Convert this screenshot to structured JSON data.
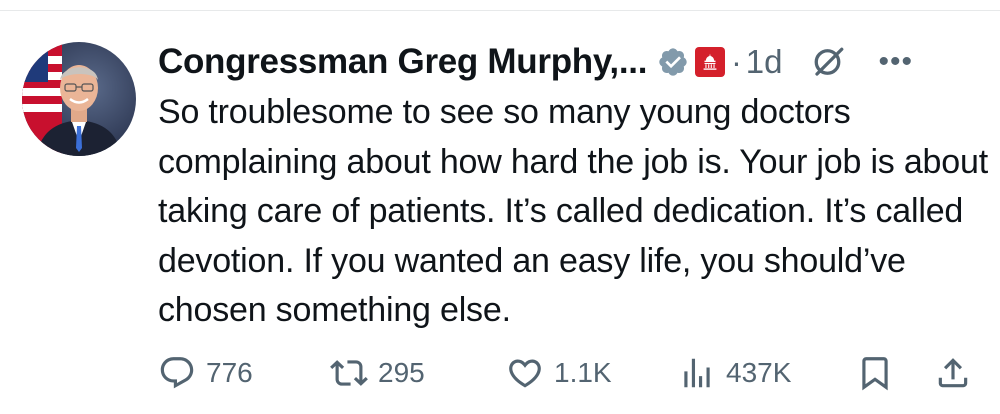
{
  "author": {
    "name": "Congressman Greg Murphy,...",
    "time": "1d",
    "dot": "·"
  },
  "icons": {
    "verified": "verified-badge-icon",
    "affiliation": "capitol-affiliation-icon",
    "grok": "grok-icon",
    "more": "more-icon",
    "reply": "reply-icon",
    "repost": "repost-icon",
    "like": "heart-icon",
    "views": "views-icon",
    "bookmark": "bookmark-icon",
    "share": "share-icon"
  },
  "tweet": {
    "text": "So troublesome to see so many young doctors complaining about how hard the job is. Your job is about taking care of patients. It’s called dedication. It’s called devotion. If you wanted an easy life, you should’ve chosen something else."
  },
  "metrics": {
    "replies": "776",
    "reposts": "295",
    "likes": "1.1K",
    "views": "437K"
  },
  "colors": {
    "text": "#0f1419",
    "secondary": "#536471",
    "verified_badge": "#829aab",
    "affiliation_bg": "#d4202b"
  }
}
